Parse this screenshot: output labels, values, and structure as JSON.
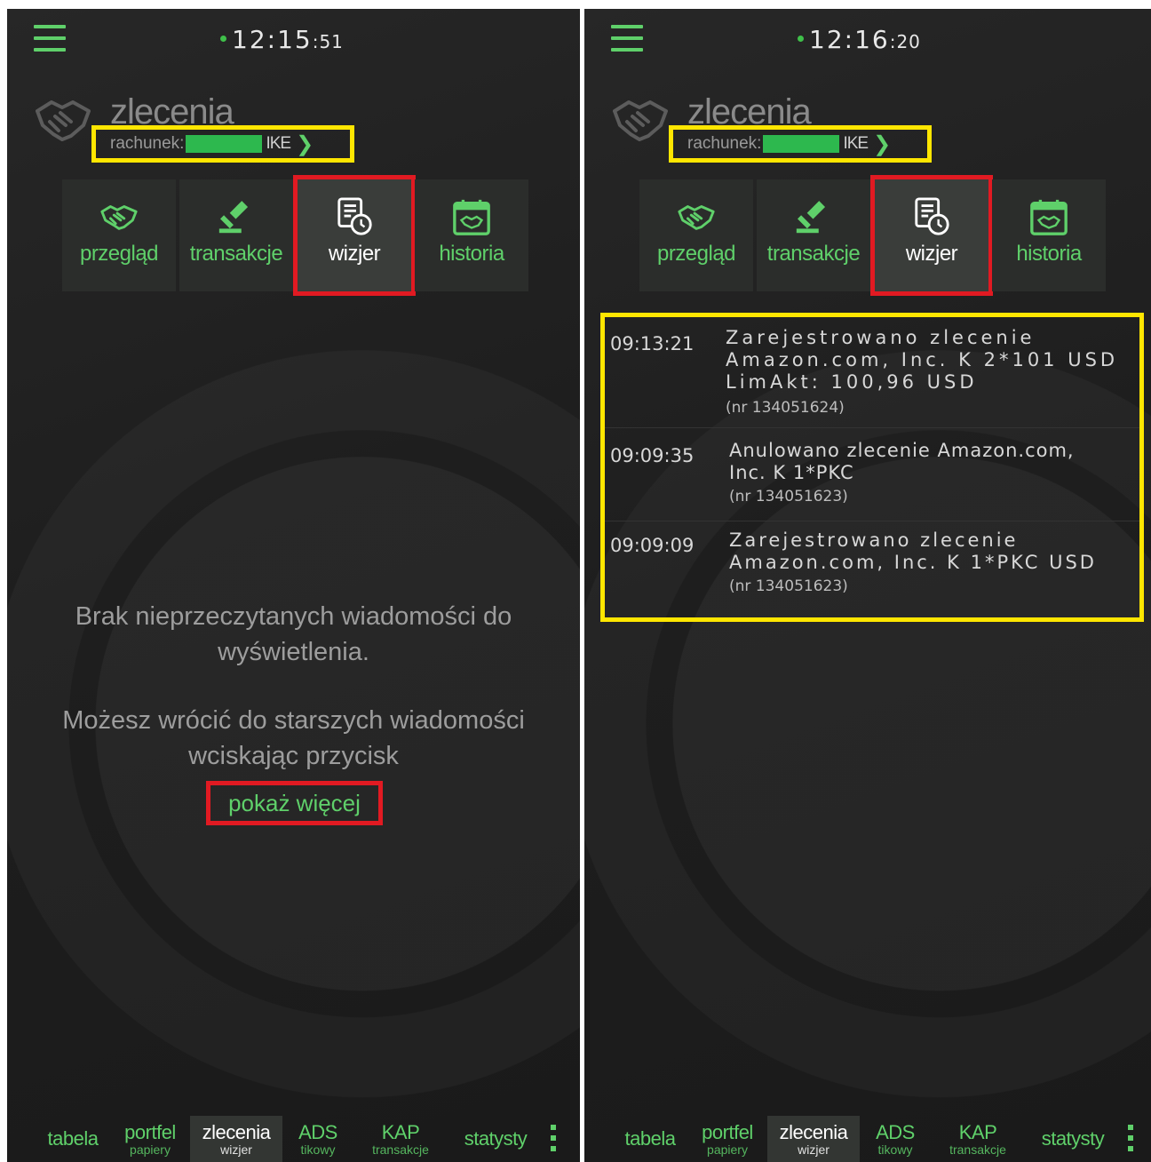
{
  "left": {
    "clock": {
      "hm": "12:15",
      "sec": ":51"
    },
    "title": "zlecenia",
    "account": {
      "label": "rachunek:",
      "type": "IKE"
    },
    "tabs": [
      {
        "label": "przegląd",
        "icon": "handshake-icon"
      },
      {
        "label": "transakcje",
        "icon": "gavel-icon"
      },
      {
        "label": "wizjer",
        "icon": "document-clock-icon",
        "active": true
      },
      {
        "label": "historia",
        "icon": "calendar-handshake-icon"
      }
    ],
    "empty": {
      "line1": "Brak nieprzeczytanych wiadomości do",
      "line2": "wyświetlenia.",
      "line3": "Możesz wrócić do starszych wiadomości",
      "line4": "wciskając przycisk",
      "button": "pokaż więcej"
    }
  },
  "right": {
    "clock": {
      "hm": "12:16",
      "sec": ":20"
    },
    "title": "zlecenia",
    "account": {
      "label": "rachunek:",
      "type": "IKE"
    },
    "tabs": [
      {
        "label": "przegląd"
      },
      {
        "label": "transakcje"
      },
      {
        "label": "wizjer",
        "active": true
      },
      {
        "label": "historia"
      }
    ],
    "messages": [
      {
        "time": "09:13:21",
        "text": "Zarejestrowano zlecenie\nAmazon.com, Inc. K 2*101 USD\nLimAkt: 100,96 USD",
        "nr": "(nr 134051624)"
      },
      {
        "time": "09:09:35",
        "text": "Anulowano zlecenie  Amazon.com,\nInc. K 1*PKC",
        "nr": "(nr 134051623)"
      },
      {
        "time": "09:09:09",
        "text": "Zarejestrowano zlecenie\nAmazon.com, Inc. K 1*PKC USD",
        "nr": "(nr 134051623)"
      }
    ]
  },
  "bottom_nav": [
    {
      "main": "tabela",
      "sub": ""
    },
    {
      "main": "portfel",
      "sub": "papiery"
    },
    {
      "main": "zlecenia",
      "sub": "wizjer",
      "active": true
    },
    {
      "main": "ADS",
      "sub": "tikowy"
    },
    {
      "main": "KAP",
      "sub": "transakcje"
    },
    {
      "main": "statysty",
      "sub": ""
    }
  ],
  "colors": {
    "accent": "#5fd06a",
    "highlight_yellow": "#ffe600",
    "highlight_red": "#e11a22",
    "background": "#1e1e1e"
  }
}
